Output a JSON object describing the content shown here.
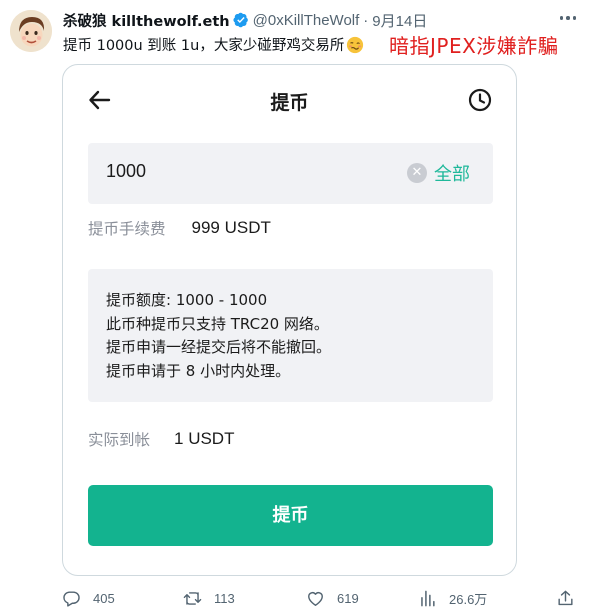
{
  "tweet": {
    "display_name": "杀破狼 killthewolf.eth",
    "handle": "@0xKillTheWolf",
    "separator": "·",
    "date": "9月14日",
    "text": "提币 1000u 到账 1u，大家少碰野鸡交易所",
    "emoji": "woozy-face",
    "overlay_caption": "暗指JPEX涉嫌詐騙"
  },
  "withdraw_screen": {
    "title": "提币",
    "amount_value": "1000",
    "clear_symbol": "✕",
    "all_label": "全部",
    "fee_label": "提币手续费",
    "fee_value": "999 USDT",
    "notice_lines": [
      "提币额度: 1000 - 1000",
      "此币种提币只支持 TRC20 网络。",
      "提币申请一经提交后将不能撤回。",
      "提币申请于 8 小时内处理。"
    ],
    "received_label": "实际到帐",
    "received_value": "1 USDT",
    "submit_label": "提币",
    "accent_color": "#13b38f"
  },
  "actions": {
    "replies": "405",
    "retweets": "113",
    "likes": "619",
    "views": "26.6万"
  },
  "colors": {
    "caption": "#e0201f",
    "verified": "#1d9bf0",
    "muted": "#536471"
  }
}
